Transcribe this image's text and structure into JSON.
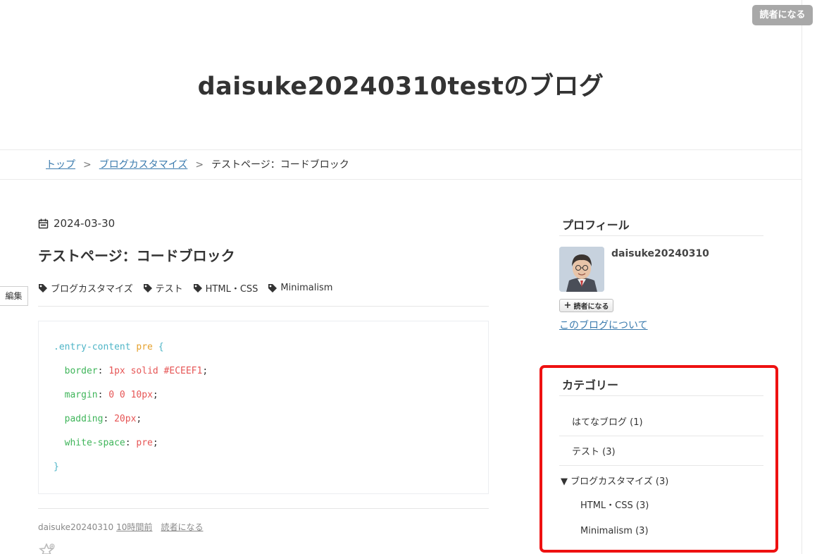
{
  "header": {
    "subscribe_label": "読者になる",
    "blog_title": "daisuke20240310testのブログ"
  },
  "breadcrumb": {
    "items": [
      "トップ",
      "ブログカスタマイズ"
    ],
    "separator": ">",
    "current": "テストページ：コードブロック"
  },
  "entry": {
    "date": "2024-03-30",
    "title": "テストページ：コードブロック",
    "edit_label": "編集",
    "tags": [
      "ブログカスタマイズ",
      "テスト",
      "HTML・CSS",
      "Minimalism"
    ],
    "code": {
      "selector": ".entry-content",
      "element": "pre",
      "open_brace": "{",
      "close_brace": "}",
      "declarations": [
        {
          "property": "border",
          "value": "1px solid #ECEEF1"
        },
        {
          "property": "margin",
          "value": "0 0 10px"
        },
        {
          "property": "padding",
          "value": "20px"
        },
        {
          "property": "white-space",
          "value": "pre"
        }
      ]
    },
    "footer": {
      "author": "daisuke20240310",
      "time_ago": "10時間前",
      "subscribe_label": "読者になる"
    }
  },
  "sidebar": {
    "profile": {
      "heading": "プロフィール",
      "name": "daisuke20240310",
      "follow_label": "読者になる",
      "about_link": "このブログについて"
    },
    "categories": {
      "heading": "カテゴリー",
      "items": [
        {
          "label": "はてなブログ (1)"
        },
        {
          "label": "テスト (3)"
        },
        {
          "label": "▼ ブログカスタマイズ (3)"
        },
        {
          "label": "HTML・CSS (3)"
        },
        {
          "label": "Minimalism (3)"
        }
      ]
    }
  },
  "colors": {
    "link": "#3b7bae",
    "highlight": "#ee1111",
    "code_selector": "#4fb5c7",
    "code_element": "#e5a12d",
    "code_property": "#3fb55a",
    "code_value": "#e65555"
  }
}
